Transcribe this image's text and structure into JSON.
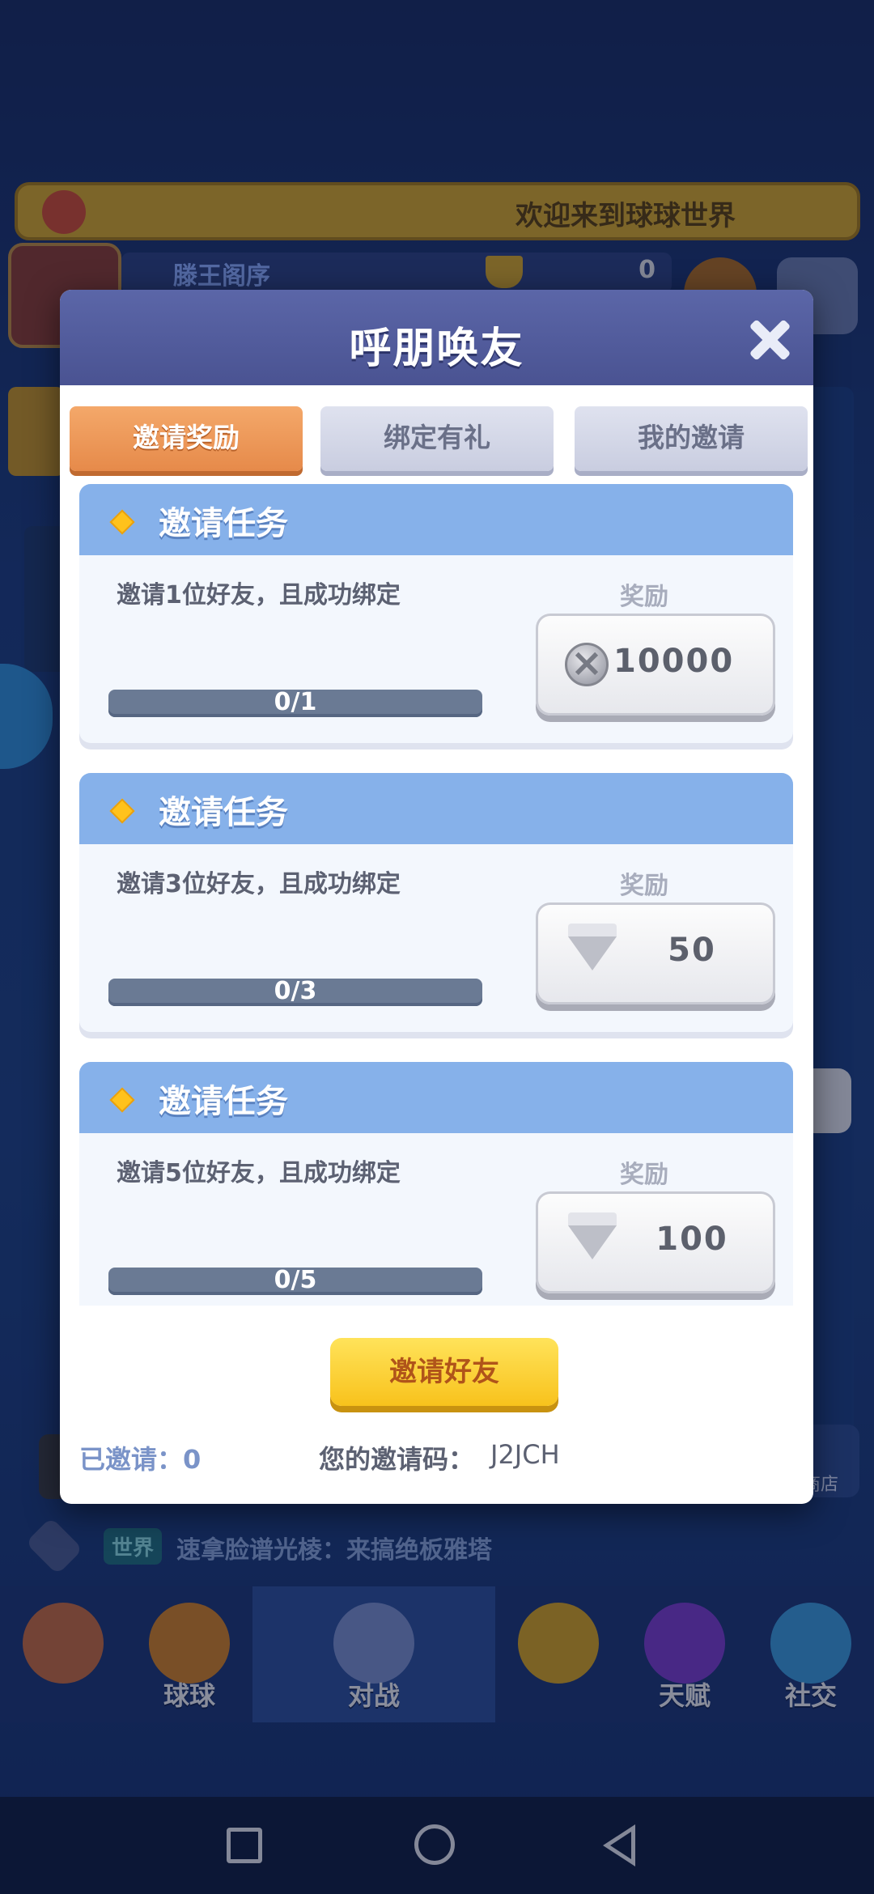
{
  "background": {
    "banner_text": "欢迎来到球球世界",
    "player_name": "滕王阁序",
    "trophy_count": "0",
    "chat_channel": "世界",
    "chat_message": "速拿脸谱光棱：来搞绝板雅塔",
    "shop_label": "商店",
    "nav": [
      {
        "label": "",
        "icon": "home-icon"
      },
      {
        "label": "球球",
        "icon": "ball-icon"
      },
      {
        "label": "对战",
        "icon": "swords-icon"
      },
      {
        "label": "",
        "icon": "whistle-icon"
      },
      {
        "label": "天赋",
        "icon": "planet-icon"
      },
      {
        "label": "社交",
        "icon": "heart-chat-icon"
      }
    ]
  },
  "dialog": {
    "title": "呼朋唤友",
    "tabs": [
      {
        "label": "邀请奖励",
        "active": true
      },
      {
        "label": "绑定有礼",
        "active": false
      },
      {
        "label": "我的邀请",
        "active": false
      }
    ],
    "tasks": [
      {
        "title": "邀请任务",
        "description": "邀请1位好友，且成功绑定",
        "reward_label": "奖励",
        "progress_text": "0/1",
        "progress": 0,
        "reward_icon": "coin-icon",
        "reward_amount": "10000"
      },
      {
        "title": "邀请任务",
        "description": "邀请3位好友，且成功绑定",
        "reward_label": "奖励",
        "progress_text": "0/3",
        "progress": 0,
        "reward_icon": "diamond-icon",
        "reward_amount": "50"
      },
      {
        "title": "邀请任务",
        "description": "邀请5位好友，且成功绑定",
        "reward_label": "奖励",
        "progress_text": "0/5",
        "progress": 0,
        "reward_icon": "diamond-icon",
        "reward_amount": "100"
      }
    ],
    "invite_button": "邀请好友",
    "invited_count": "已邀请：0",
    "invite_code_label": "您的邀请码：",
    "invite_code": "J2JCH"
  },
  "colors": {
    "accent_tab": "#e68a4a",
    "task_header": "#86b1ea",
    "invite_button": "#f8c21c"
  }
}
